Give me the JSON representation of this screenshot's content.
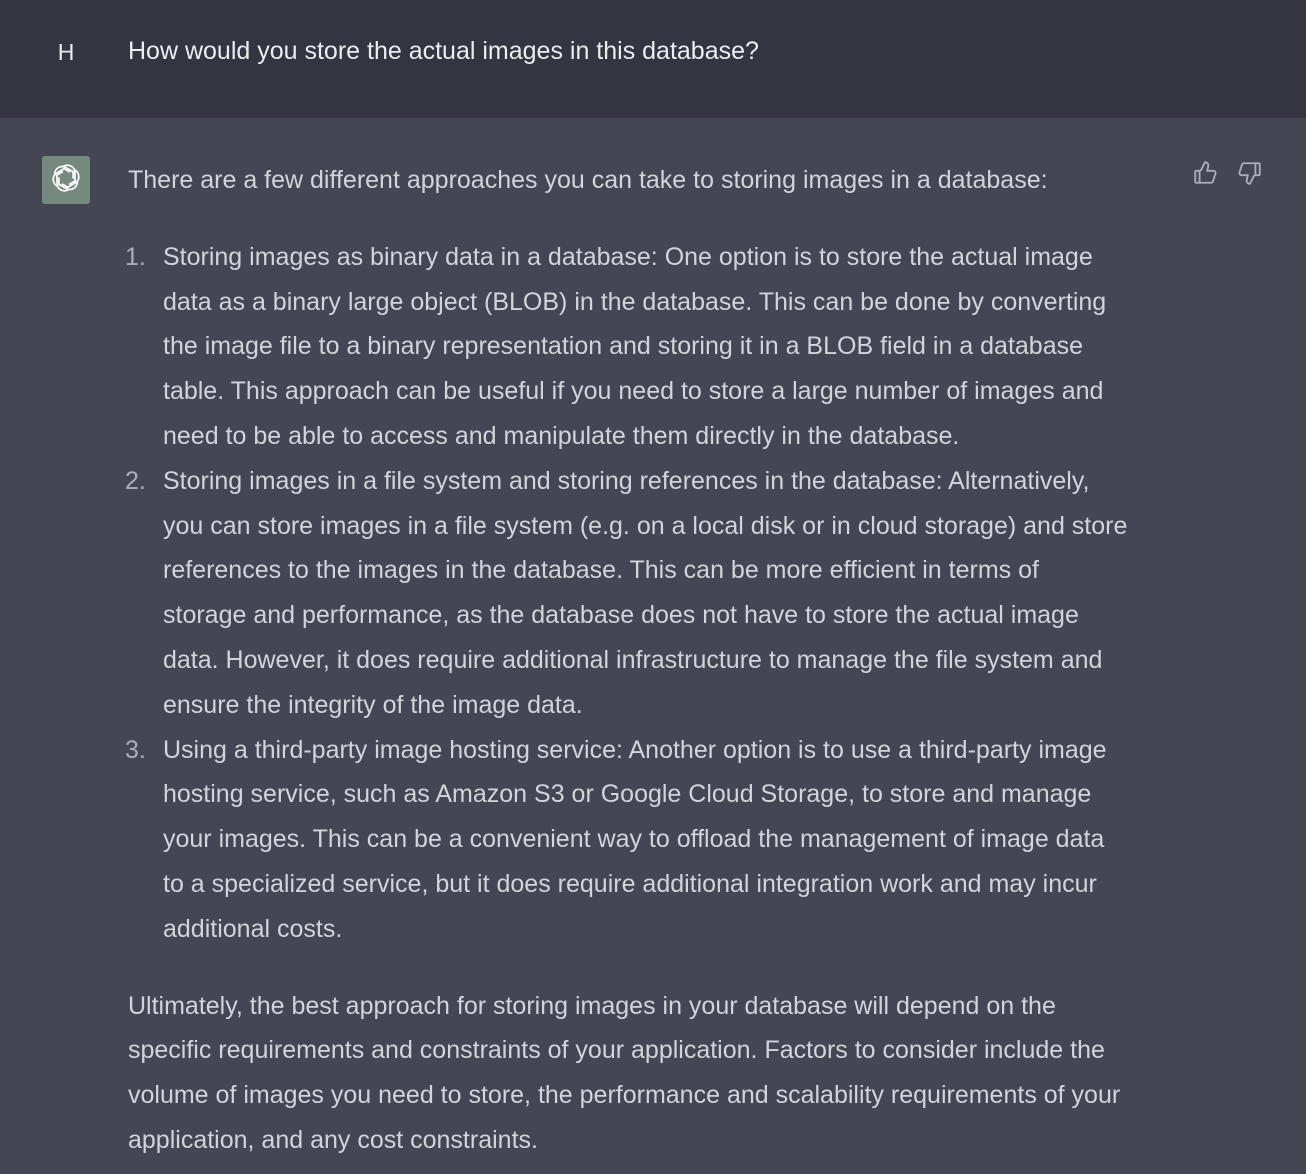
{
  "user": {
    "avatar_initial": "H",
    "message": "How would you store the actual images in this database?"
  },
  "assistant": {
    "avatar_icon": "openai-logo-icon",
    "avatar_color": "#75897f",
    "intro": "There are a few different approaches you can take to storing images in a database:",
    "items": [
      {
        "number": "1.",
        "lines": [
          "Storing images as binary data in a database: One option is to store the actual image",
          "data as a binary large object (BLOB) in the database. This can be done by converting",
          "the image file to a binary representation and storing it in a BLOB field in a database",
          "table. This approach can be useful if you need to store a large number of images and",
          "need to be able to access and manipulate them directly in the database."
        ]
      },
      {
        "number": "2.",
        "lines": [
          "Storing images in a file system and storing references in the database: Alternatively,",
          "you can store images in a file system (e.g. on a local disk or in cloud storage) and store",
          "references to the images in the database. This can be more efficient in terms of",
          "storage and performance, as the database does not have to store the actual image",
          "data. However, it does require additional infrastructure to manage the file system and",
          "ensure the integrity of the image data."
        ]
      },
      {
        "number": "3.",
        "lines": [
          "Using a third-party image hosting service: Another option is to use a third-party image",
          "hosting service, such as Amazon S3 or Google Cloud Storage, to store and manage",
          "your images. This can be a convenient way to offload the management of image data",
          "to a specialized service, but it does require additional integration work and may incur",
          "additional costs."
        ]
      }
    ],
    "conclusion_lines": [
      "Ultimately, the best approach for storing images in your database will depend on the",
      "specific requirements and constraints of your application. Factors to consider include the",
      "volume of images you need to store, the performance and scalability requirements of your",
      "application, and any cost constraints."
    ],
    "feedback": {
      "thumbs_up_icon": "thumbs-up-icon",
      "thumbs_down_icon": "thumbs-down-icon"
    }
  },
  "colors": {
    "user_bg": "#343541",
    "assistant_bg": "#444654",
    "text": "#d1d5db",
    "list_number": "#acacbe"
  }
}
